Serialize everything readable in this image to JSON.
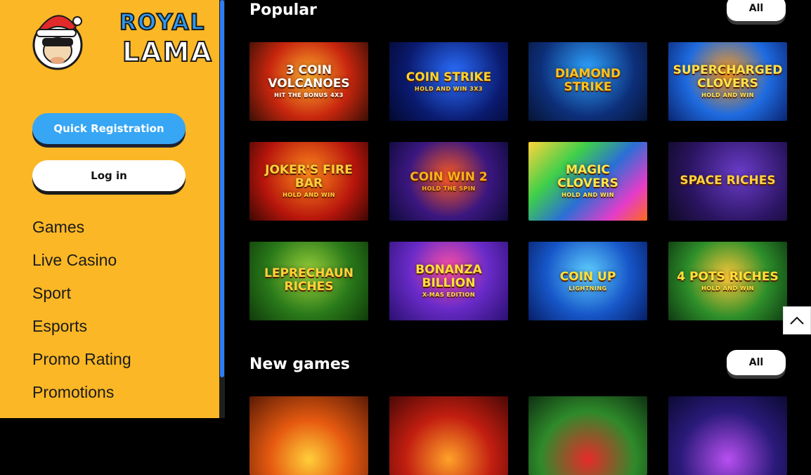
{
  "brand": {
    "line1": "ROYAL",
    "line2": "LAMA"
  },
  "sidebar": {
    "register_label": "Quick Registration",
    "login_label": "Log in",
    "nav": [
      {
        "label": "Games"
      },
      {
        "label": "Live Casino"
      },
      {
        "label": "Sport"
      },
      {
        "label": "Esports"
      },
      {
        "label": "Promo Rating"
      },
      {
        "label": "Promotions"
      }
    ]
  },
  "popular": {
    "title": "Popular",
    "all_label": "All",
    "games": [
      {
        "title": "3 Coin Volcanoes",
        "sub": "HIT the BONUS 4x3"
      },
      {
        "title": "Coin Strike",
        "sub": "HOLD AND WIN 3x3"
      },
      {
        "title": "Diamond Strike",
        "sub": ""
      },
      {
        "title": "Supercharged Clovers",
        "sub": "HOLD AND WIN"
      },
      {
        "title": "Joker's Fire Bar",
        "sub": "HOLD AND WIN"
      },
      {
        "title": "Coin Win 2",
        "sub": "HOLD THE SPIN"
      },
      {
        "title": "Magic Clovers",
        "sub": "HOLD AND WIN"
      },
      {
        "title": "Space Riches",
        "sub": ""
      },
      {
        "title": "Leprechaun Riches",
        "sub": ""
      },
      {
        "title": "Bonanza Billion",
        "sub": "X-mas Edition"
      },
      {
        "title": "Coin Up",
        "sub": "LIGHTNING"
      },
      {
        "title": "4 Pots Riches",
        "sub": "HOLD AND WIN"
      }
    ]
  },
  "new_games": {
    "title": "New games",
    "all_label": "All"
  },
  "colors": {
    "sidebar_bg": "#fbb725",
    "register_btn": "#36a6f5",
    "scrollbar_thumb": "#2f7cf6"
  }
}
